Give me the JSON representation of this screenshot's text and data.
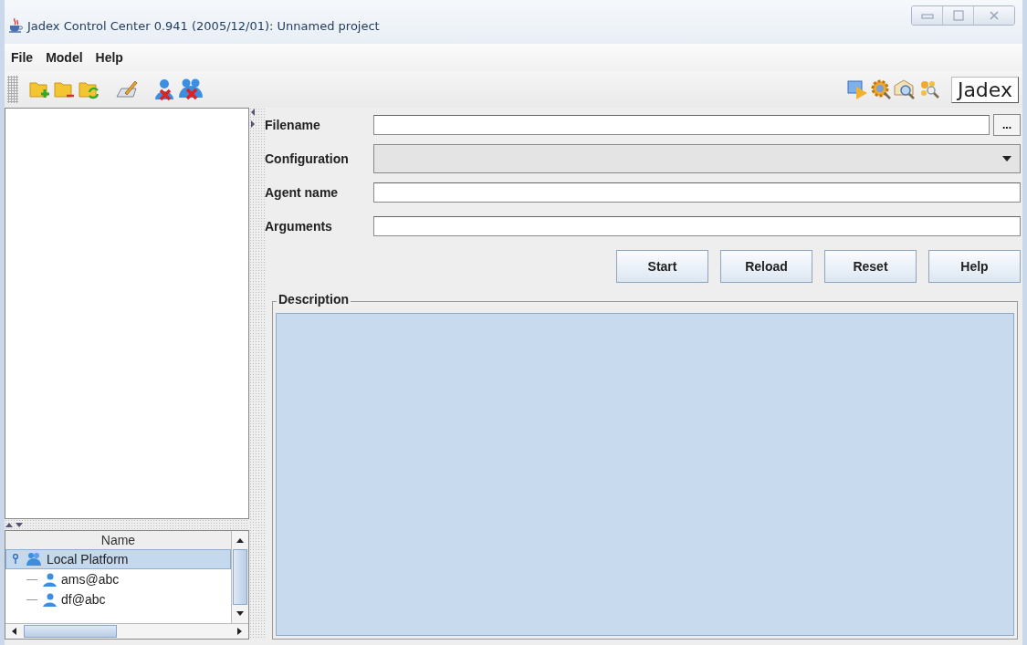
{
  "window": {
    "title": "Jadex Control Center 0.941 (2005/12/01): Unnamed project"
  },
  "menu": [
    "File",
    "Model",
    "Help"
  ],
  "toolbar": {
    "logo": "Jadex"
  },
  "platform_table": {
    "header": "Name",
    "tree": [
      {
        "label": "Local Platform",
        "expanded": true,
        "selected": true,
        "children": [
          {
            "label": "ams@abc",
            "selected": false
          },
          {
            "label": "df@abc",
            "selected": false
          }
        ]
      }
    ]
  },
  "form": {
    "fields": [
      {
        "label": "Filename",
        "kind": "text",
        "disabled": false,
        "browse": "..."
      },
      {
        "label": "Configuration",
        "kind": "combo",
        "disabled": true
      },
      {
        "label": "Agent name",
        "kind": "text",
        "disabled": false
      },
      {
        "label": "Arguments",
        "kind": "text",
        "disabled": false
      }
    ],
    "buttons": [
      "Start",
      "Reload",
      "Reset",
      "Help"
    ],
    "description": {
      "title": "Description"
    }
  }
}
